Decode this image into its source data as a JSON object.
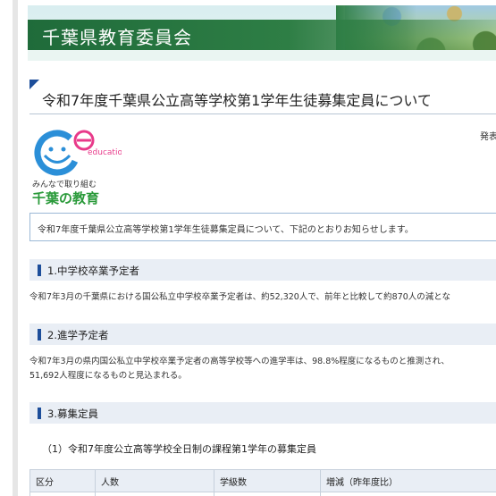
{
  "header": {
    "title": "千葉県教育委員会"
  },
  "page_title": "令和7年度千葉県公立高等学校第1学年生徒募集定員について",
  "logo": {
    "mark_text": "education",
    "tagline": "みんなで取り組む",
    "name": "千葉の教育"
  },
  "date_label": "発表",
  "notice": "令和7年度千葉県公立高等学校第1学年生徒募集定員について、下記のとおりお知らせします。",
  "sections": [
    {
      "heading": "1.中学校卒業予定者",
      "lines": [
        "令和7年3月の千葉県における国公私立中学校卒業予定者は、約52,320人で、前年と比較して約870人の減とな"
      ]
    },
    {
      "heading": "2.進学予定者",
      "lines": [
        "令和7年3月の県内国公私立中学校卒業予定者の高等学校等への進学率は、98.8%程度になるものと推測され、",
        "51,692人程度になるものと見込まれる。"
      ]
    },
    {
      "heading": "3.募集定員",
      "lines": []
    }
  ],
  "subheading": "（1）令和7年度公立高等学校全日制の課程第1学年の募集定員",
  "table": {
    "headers": [
      "区分",
      "人数",
      "学級数",
      "増減（昨年度比）"
    ]
  },
  "colors": {
    "brand_green": "#2e7e45",
    "accent_blue": "#1d4e9a",
    "section_bg": "#e9eef5"
  }
}
